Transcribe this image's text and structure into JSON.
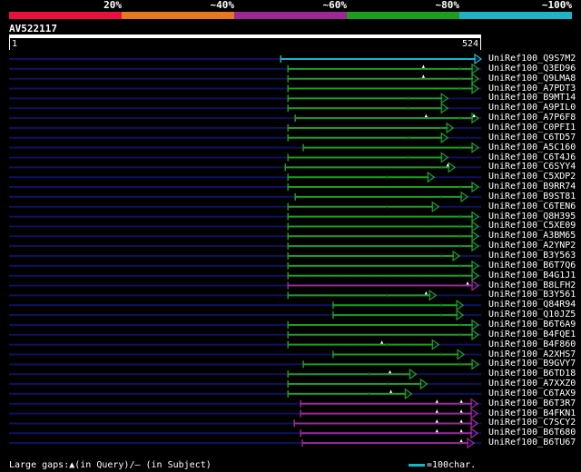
{
  "colors": {
    "band_20": "#e8103c",
    "band_40": "#e8781e",
    "band_60": "#9c2896",
    "band_80": "#1e9c1e",
    "band_100": "#1eb4c8",
    "query_line": "#101060",
    "tick": "#1e9c1e"
  },
  "legend": [
    {
      "label": "20%",
      "color": "#e8103c"
    },
    {
      "label": "~40%",
      "color": "#e8781e"
    },
    {
      "label": "~60%",
      "color": "#9c2896"
    },
    {
      "label": "~80%",
      "color": "#1e9c1e"
    },
    {
      "label": "~100%",
      "color": "#1eb4c8"
    }
  ],
  "query": {
    "id": "AV522117",
    "start_label": "1",
    "end_label": "524",
    "length": 524
  },
  "hits": [
    {
      "name": "UniRef100_Q9S7M2",
      "start": 302,
      "end": 524,
      "band": 4,
      "gaps": []
    },
    {
      "name": "UniRef100_Q3ED96",
      "start": 310,
      "end": 521,
      "band": 3,
      "gaps": [
        460
      ],
      "mid": 501
    },
    {
      "name": "UniRef100_Q9LMA8",
      "start": 310,
      "end": 521,
      "band": 3,
      "gaps": [
        460
      ],
      "mid": 501
    },
    {
      "name": "UniRef100_A7PDT3",
      "start": 310,
      "end": 521,
      "band": 3,
      "gaps": [],
      "mid": 501
    },
    {
      "name": "UniRef100_B9MT14",
      "start": 310,
      "end": 487,
      "band": 3,
      "gaps": [],
      "mid": 443
    },
    {
      "name": "UniRef100_A9PIL0",
      "start": 310,
      "end": 487,
      "band": 3,
      "gaps": [],
      "mid": 443
    },
    {
      "name": "UniRef100_A7P6F8",
      "start": 318,
      "end": 521,
      "band": 3,
      "gaps": [
        463,
        516
      ],
      "mid": 501
    },
    {
      "name": "UniRef100_C0PFI1",
      "start": 310,
      "end": 493,
      "band": 3,
      "gaps": [],
      "mid": 480
    },
    {
      "name": "UniRef100_C6TD57",
      "start": 310,
      "end": 487,
      "band": 3,
      "gaps": [],
      "mid": 443
    },
    {
      "name": "UniRef100_A5C160",
      "start": 327,
      "end": 521,
      "band": 3,
      "gaps": [],
      "mid": 501
    },
    {
      "name": "UniRef100_C6T4J6",
      "start": 310,
      "end": 487,
      "band": 3,
      "gaps": [],
      "mid": 443
    },
    {
      "name": "UniRef100_C6SYY4",
      "start": 307,
      "end": 495,
      "band": 3,
      "gaps": [
        487
      ],
      "mid": 480
    },
    {
      "name": "UniRef100_C5XDP2",
      "start": 310,
      "end": 472,
      "band": 3,
      "gaps": [],
      "mid": 420
    },
    {
      "name": "UniRef100_B9RR74",
      "start": 310,
      "end": 521,
      "band": 3,
      "gaps": [],
      "mid": 501
    },
    {
      "name": "UniRef100_B9ST81",
      "start": 318,
      "end": 509,
      "band": 3,
      "gaps": [],
      "mid": 480
    },
    {
      "name": "UniRef100_C6TEN6",
      "start": 310,
      "end": 477,
      "band": 3,
      "gaps": [],
      "mid": 420
    },
    {
      "name": "UniRef100_Q8H395",
      "start": 310,
      "end": 521,
      "band": 3,
      "gaps": [],
      "mid": 501
    },
    {
      "name": "UniRef100_C5XE09",
      "start": 310,
      "end": 521,
      "band": 3,
      "gaps": [],
      "mid": 501
    },
    {
      "name": "UniRef100_A3BM65",
      "start": 310,
      "end": 521,
      "band": 3,
      "gaps": [],
      "mid": 501
    },
    {
      "name": "UniRef100_A2YNP2",
      "start": 310,
      "end": 521,
      "band": 3,
      "gaps": [],
      "mid": 501
    },
    {
      "name": "UniRef100_B3Y563",
      "start": 310,
      "end": 500,
      "band": 3,
      "gaps": [],
      "mid": 480
    },
    {
      "name": "UniRef100_B6T7Q6",
      "start": 310,
      "end": 521,
      "band": 3,
      "gaps": [],
      "mid": 501
    },
    {
      "name": "UniRef100_B4G1J1",
      "start": 310,
      "end": 521,
      "band": 3,
      "gaps": [],
      "mid": 501
    },
    {
      "name": "UniRef100_B8LFH2",
      "start": 310,
      "end": 521,
      "band": 2,
      "gaps": [
        509
      ],
      "mid": 501
    },
    {
      "name": "UniRef100_B3Y561",
      "start": 310,
      "end": 474,
      "band": 3,
      "gaps": [
        463
      ],
      "mid": 420
    },
    {
      "name": "UniRef100_Q84R94",
      "start": 360,
      "end": 504,
      "band": 3,
      "gaps": [],
      "mid": 480
    },
    {
      "name": "UniRef100_Q10JZ5",
      "start": 360,
      "end": 504,
      "band": 3,
      "gaps": [],
      "mid": 480
    },
    {
      "name": "UniRef100_B6T6A9",
      "start": 310,
      "end": 521,
      "band": 3,
      "gaps": [],
      "mid": 501
    },
    {
      "name": "UniRef100_B4FQE1",
      "start": 310,
      "end": 521,
      "band": 3,
      "gaps": [],
      "mid": 501
    },
    {
      "name": "UniRef100_B4F860",
      "start": 310,
      "end": 477,
      "band": 3,
      "gaps": [
        414
      ],
      "mid": 420
    },
    {
      "name": "UniRef100_A2XHS7",
      "start": 360,
      "end": 505,
      "band": 3,
      "gaps": [],
      "mid": 480
    },
    {
      "name": "UniRef100_B9GVY7",
      "start": 327,
      "end": 521,
      "band": 3,
      "gaps": [],
      "mid": 501
    },
    {
      "name": "UniRef100_B6TD18",
      "start": 310,
      "end": 452,
      "band": 3,
      "gaps": [
        423
      ],
      "mid": 400
    },
    {
      "name": "UniRef100_A7XXZ0",
      "start": 310,
      "end": 464,
      "band": 3,
      "gaps": [],
      "mid": 420
    },
    {
      "name": "UniRef100_C6TAX9",
      "start": 310,
      "end": 447,
      "band": 3,
      "gaps": [
        424
      ],
      "mid": 400
    },
    {
      "name": "UniRef100_B6T3R7",
      "start": 324,
      "end": 520,
      "band": 2,
      "gaps": [
        475,
        502
      ],
      "mid": 501
    },
    {
      "name": "UniRef100_B4FKN1",
      "start": 324,
      "end": 520,
      "band": 2,
      "gaps": [
        475,
        502
      ],
      "mid": 501
    },
    {
      "name": "UniRef100_C7SCY2",
      "start": 317,
      "end": 520,
      "band": 2,
      "gaps": [
        475,
        502
      ],
      "mid": 501
    },
    {
      "name": "UniRef100_B6T680",
      "start": 324,
      "end": 520,
      "band": 2,
      "gaps": [
        475,
        502
      ],
      "mid": 501
    },
    {
      "name": "UniRef100_B6TU67",
      "start": 326,
      "end": 516,
      "band": 2,
      "gaps": [
        502
      ],
      "mid": 501
    }
  ],
  "footer": {
    "large_gaps": "Large gaps:▲(in Query)/– (in Subject)",
    "scale": "=100char."
  }
}
